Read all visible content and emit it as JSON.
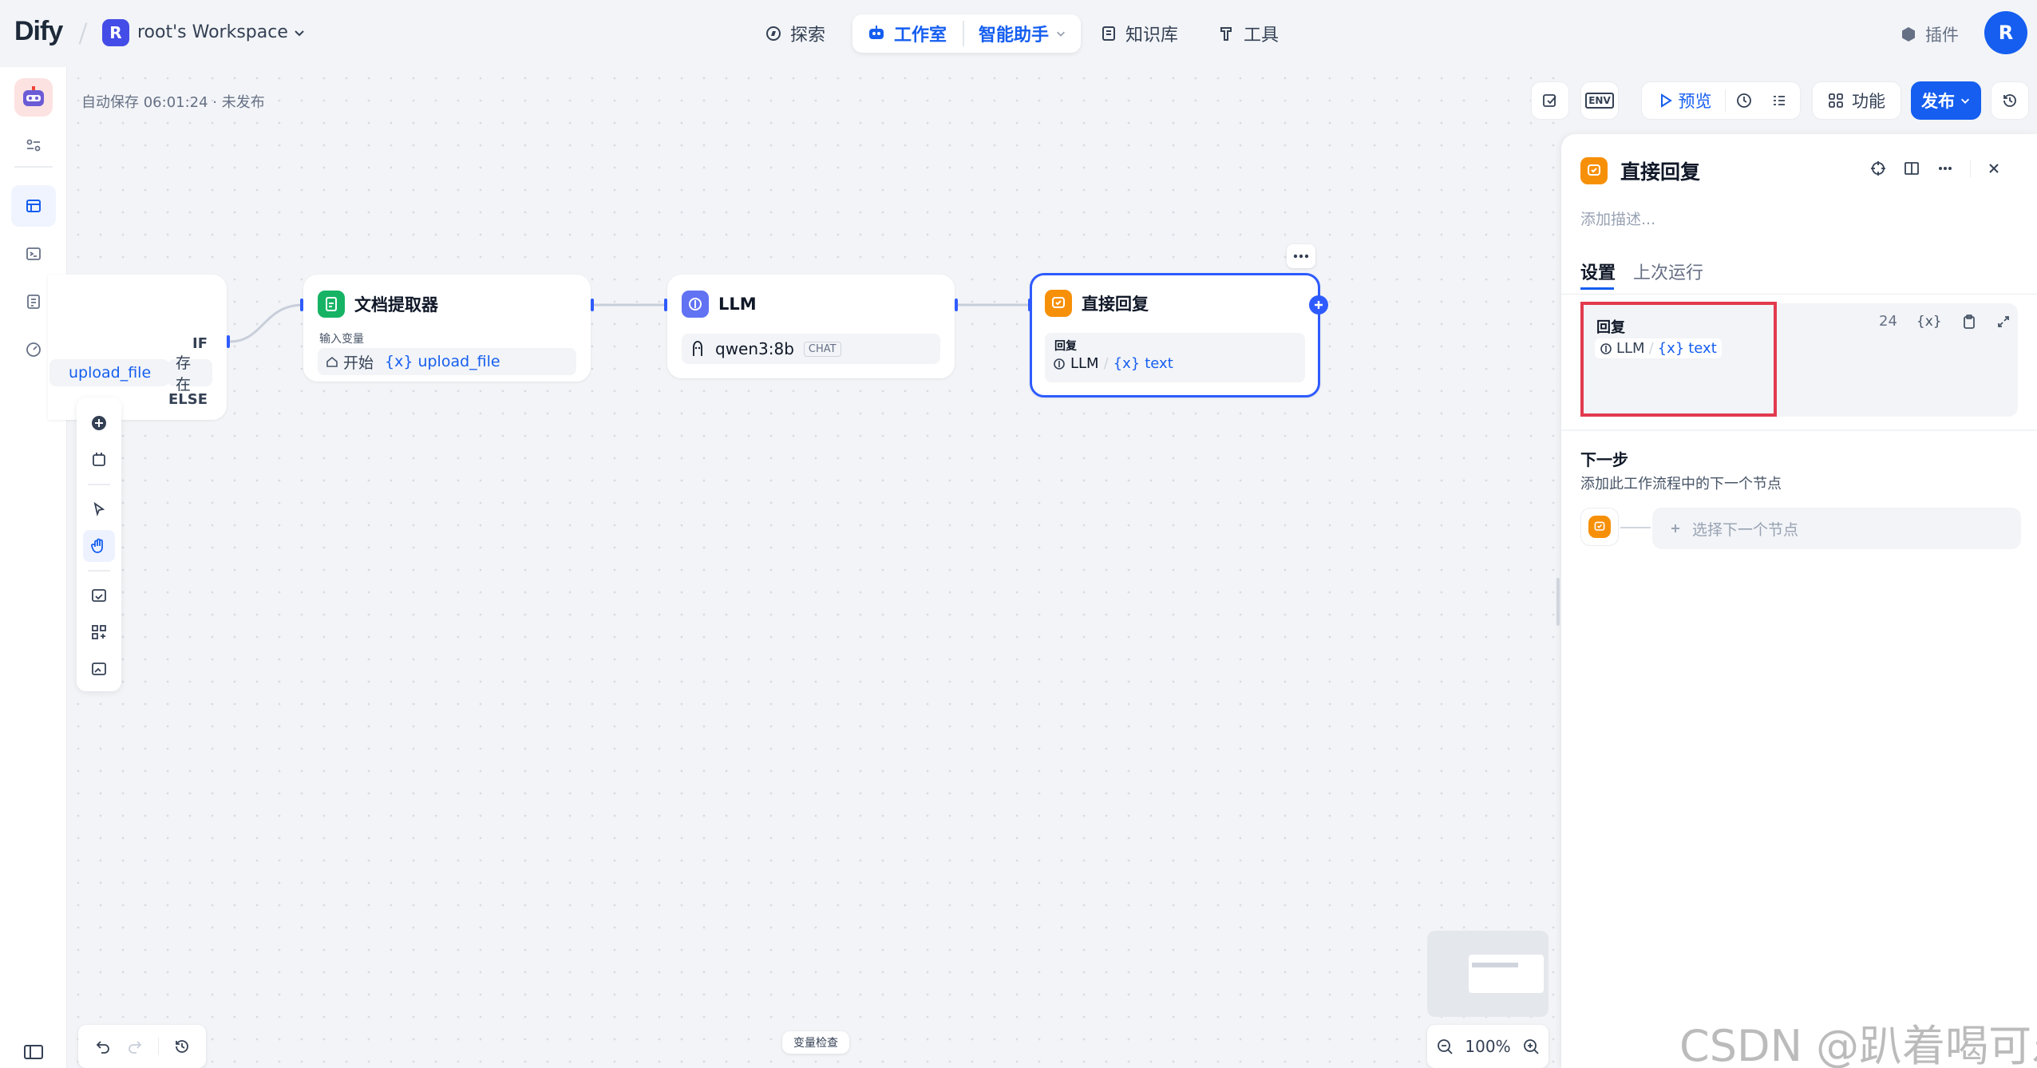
{
  "app": {
    "logo": "Dify",
    "workspace_initial": "R",
    "workspace_name": "root's Workspace",
    "user_initial": "R"
  },
  "nav": {
    "explore": "探索",
    "studio": "工作室",
    "assistant": "智能助手",
    "knowledge": "知识库",
    "tools": "工具",
    "plugins": "插件"
  },
  "status": {
    "autosave": "自动保存 06:01:24 · 未发布"
  },
  "toolbar": {
    "env": "ENV",
    "preview": "预览",
    "features": "功能",
    "publish": "发布"
  },
  "nodes": {
    "ifelse": {
      "if_label": "IF",
      "var": "upload_file",
      "op": "存在",
      "else_label": "ELSE"
    },
    "doc_extractor": {
      "title": "文档提取器",
      "input_label": "输入变量",
      "source": "开始",
      "var": "upload_file"
    },
    "llm": {
      "title": "LLM",
      "model": "qwen3:8b",
      "mode": "CHAT"
    },
    "answer": {
      "title": "直接回复",
      "reply_label": "回复",
      "source": "LLM",
      "var": "text"
    }
  },
  "panel": {
    "title": "直接回复",
    "desc_placeholder": "添加描述...",
    "tab_settings": "设置",
    "tab_last_run": "上次运行",
    "reply_label": "回复",
    "reply_count": "24",
    "reply_source": "LLM",
    "reply_var": "text",
    "next_title": "下一步",
    "next_desc": "添加此工作流程中的下一个节点",
    "next_select": "选择下一个节点"
  },
  "bottom": {
    "var_inspect": "变量检查",
    "zoom": "100%"
  },
  "watermark": "CSDN @趴着喝可乐",
  "colors": {
    "accent": "#155eef",
    "llm": "#6172f3",
    "answer": "#f79009",
    "doc": "#16b364",
    "highlight": "#e23a4e"
  }
}
